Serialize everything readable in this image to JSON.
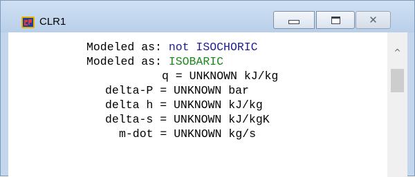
{
  "window": {
    "title": "CLR1",
    "icons": {
      "app": "app-icon",
      "minimize": "minimize-icon",
      "maximize": "maximize-icon",
      "close": "close-icon"
    }
  },
  "content": {
    "lines": [
      {
        "label": "Modeled as:",
        "value": "not ISOCHORIC",
        "value_color": "#1e1e8c"
      },
      {
        "label": "Modeled as:",
        "value": "ISOBARIC",
        "value_color": "#1b8a1b"
      },
      {
        "label": "q = UNKNOWN kJ/kg"
      },
      {
        "label": "delta-P = UNKNOWN bar"
      },
      {
        "label": "delta h = UNKNOWN kJ/kg"
      },
      {
        "label": "delta-s = UNKNOWN kJ/kgK"
      },
      {
        "label": "m-dot = UNKNOWN kg/s"
      }
    ]
  },
  "scrollbar": {
    "up_arrow": "^"
  }
}
